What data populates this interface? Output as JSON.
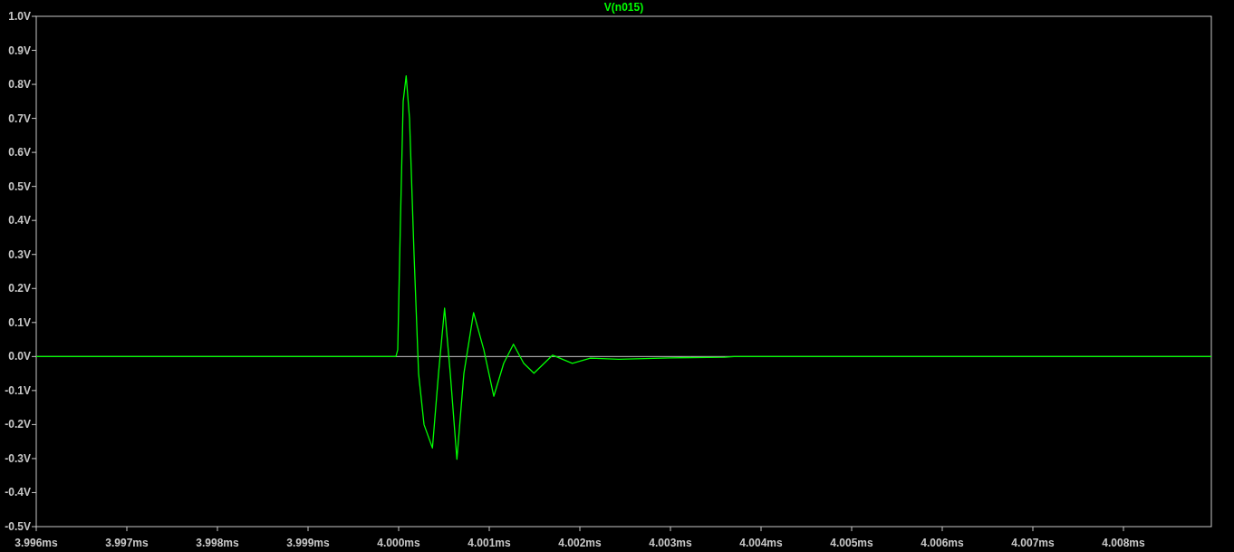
{
  "plot": {
    "chart_data": {
      "type": "line",
      "title": "V(n015)",
      "x": [
        3.996,
        3.99997,
        3.99999,
        4.00002,
        4.00005,
        4.000083,
        4.00012,
        4.00017,
        4.00022,
        4.00028,
        4.000373,
        4.00044,
        4.000507,
        4.00057,
        4.000643,
        4.00072,
        4.000827,
        4.00094,
        4.00105,
        4.00116,
        4.001267,
        4.00138,
        4.001493,
        4.0017,
        4.001917,
        4.002117,
        4.00243,
        4.003,
        4.0036,
        4.0037,
        4.00897
      ],
      "series": [
        {
          "color": "#00ff00",
          "values": [
            0,
            0,
            0.02,
            0.4,
            0.75,
            0.825,
            0.7,
            0.3,
            -0.05,
            -0.2,
            -0.269,
            -0.05,
            0.142,
            -0.05,
            -0.302,
            -0.05,
            0.129,
            0.02,
            -0.117,
            -0.02,
            0.036,
            -0.02,
            -0.049,
            0.004,
            -0.02,
            -0.005,
            -0.008,
            -0.004,
            -0.002,
            0,
            0
          ]
        }
      ],
      "xlim": [
        3.996,
        4.00897
      ],
      "ylim": [
        -0.5,
        1.0
      ],
      "xticks": [
        {
          "value": 3.996,
          "label": "3.996ms"
        },
        {
          "value": 3.997,
          "label": "3.997ms"
        },
        {
          "value": 3.998,
          "label": "3.998ms"
        },
        {
          "value": 3.999,
          "label": "3.999ms"
        },
        {
          "value": 4.0,
          "label": "4.000ms"
        },
        {
          "value": 4.001,
          "label": "4.001ms"
        },
        {
          "value": 4.002,
          "label": "4.002ms"
        },
        {
          "value": 4.003,
          "label": "4.003ms"
        },
        {
          "value": 4.004,
          "label": "4.004ms"
        },
        {
          "value": 4.005,
          "label": "4.005ms"
        },
        {
          "value": 4.006,
          "label": "4.006ms"
        },
        {
          "value": 4.007,
          "label": "4.007ms"
        },
        {
          "value": 4.008,
          "label": "4.008ms"
        }
      ],
      "yticks": [
        {
          "value": 1.0,
          "label": "1.0V"
        },
        {
          "value": 0.9,
          "label": "0.9V"
        },
        {
          "value": 0.8,
          "label": "0.8V"
        },
        {
          "value": 0.7,
          "label": "0.7V"
        },
        {
          "value": 0.6,
          "label": "0.6V"
        },
        {
          "value": 0.5,
          "label": "0.5V"
        },
        {
          "value": 0.4,
          "label": "0.4V"
        },
        {
          "value": 0.3,
          "label": "0.3V"
        },
        {
          "value": 0.2,
          "label": "0.2V"
        },
        {
          "value": 0.1,
          "label": "0.1V"
        },
        {
          "value": 0.0,
          "label": "0.0V"
        },
        {
          "value": -0.1,
          "label": "-0.1V"
        },
        {
          "value": -0.2,
          "label": "-0.2V"
        },
        {
          "value": -0.3,
          "label": "-0.3V"
        },
        {
          "value": -0.4,
          "label": "-0.4V"
        },
        {
          "value": -0.5,
          "label": "-0.5V"
        }
      ]
    }
  }
}
